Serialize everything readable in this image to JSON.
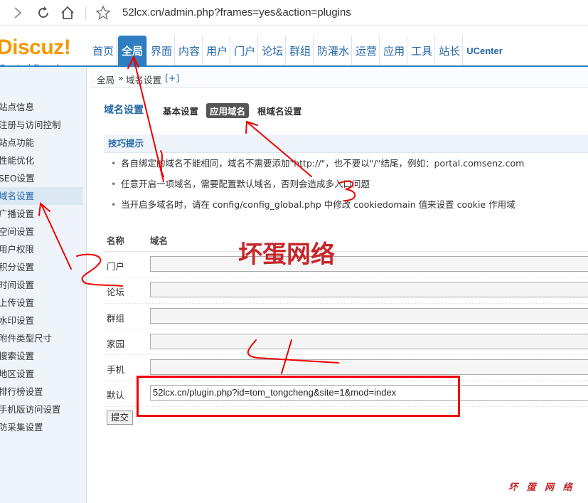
{
  "browser": {
    "url": "52lcx.cn/admin.php?frames=yes&action=plugins"
  },
  "logo": {
    "text": "Discuz!",
    "sub": "Control Panel"
  },
  "topnav": [
    "首页",
    "全局",
    "界面",
    "内容",
    "用户",
    "门户",
    "论坛",
    "群组",
    "防灌水",
    "运营",
    "应用",
    "工具",
    "站长",
    "UCenter"
  ],
  "breadcrumb": {
    "root": "全局",
    "sep": "»",
    "current": "域名设置",
    "add": "[+]"
  },
  "sidebar": [
    "站点信息",
    "注册与访问控制",
    "站点功能",
    "性能优化",
    "SEO设置",
    "域名设置",
    "广播设置",
    "空间设置",
    "用户权限",
    "积分设置",
    "时间设置",
    "上传设置",
    "水印设置",
    "附件类型尺寸",
    "搜索设置",
    "地区设置",
    "排行榜设置",
    "手机版访问设置",
    "防采集设置"
  ],
  "page": {
    "title": "域名设置",
    "tabs": [
      "基本设置",
      "应用域名",
      "根域名设置"
    ]
  },
  "tips": {
    "head": "技巧提示",
    "items": [
      "各自绑定的域名不能相同，域名不需要添加\"http://\"，也不要以\"/\"结尾，例如：portal.comsenz.com",
      "任意开启一项域名，需要配置默认域名，否则会造成多入口问题",
      "当开启多域名时，请在 config/config_global.php 中修改 cookiedomain 值来设置 cookie 作用域"
    ]
  },
  "table": {
    "col_name": "名称",
    "col_domain": "域名",
    "rows": [
      {
        "label": "门户",
        "value": ""
      },
      {
        "label": "论坛",
        "value": ""
      },
      {
        "label": "群组",
        "value": ""
      },
      {
        "label": "家园",
        "value": ""
      },
      {
        "label": "手机",
        "value": ""
      },
      {
        "label": "默认",
        "value": "52lcx.cn/plugin.php?id=tom_tongcheng&site=1&mod=index"
      }
    ]
  },
  "submit_label": "提交",
  "watermark": {
    "big": "坏蛋网络",
    "small": "坏 蛋 网 络"
  }
}
